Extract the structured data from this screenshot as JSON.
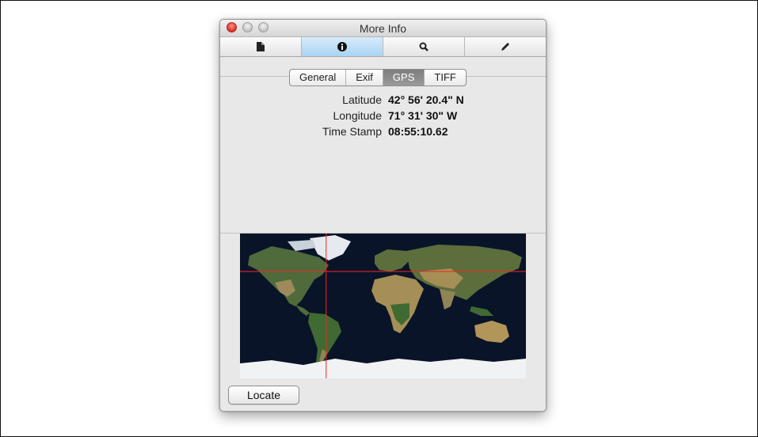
{
  "window": {
    "title": "More Info"
  },
  "toolbar": {
    "items": [
      {
        "icon": "document-icon",
        "label": ""
      },
      {
        "icon": "info-icon",
        "label": "",
        "active": true
      },
      {
        "icon": "magnifier-icon",
        "label": ""
      },
      {
        "icon": "pencil-icon",
        "label": ""
      }
    ]
  },
  "tabs": {
    "items": [
      {
        "label": "General"
      },
      {
        "label": "Exif"
      },
      {
        "label": "GPS"
      },
      {
        "label": "TIFF"
      }
    ],
    "selected": "GPS"
  },
  "gps": {
    "latitude_label": "Latitude",
    "latitude_value": "42° 56' 20.4\" N",
    "longitude_label": "Longitude",
    "longitude_value": "71° 31' 30\" W",
    "timestamp_label": "Time Stamp",
    "timestamp_value": "08:55:10.62"
  },
  "map": {
    "marker_latitude": 42.939,
    "marker_longitude": -71.525,
    "crosshair_color": "#ff2020"
  },
  "buttons": {
    "locate_label": "Locate"
  },
  "colors": {
    "selected_toolbar": "#b6dbf6",
    "selected_tab": "#8a8a8a"
  }
}
